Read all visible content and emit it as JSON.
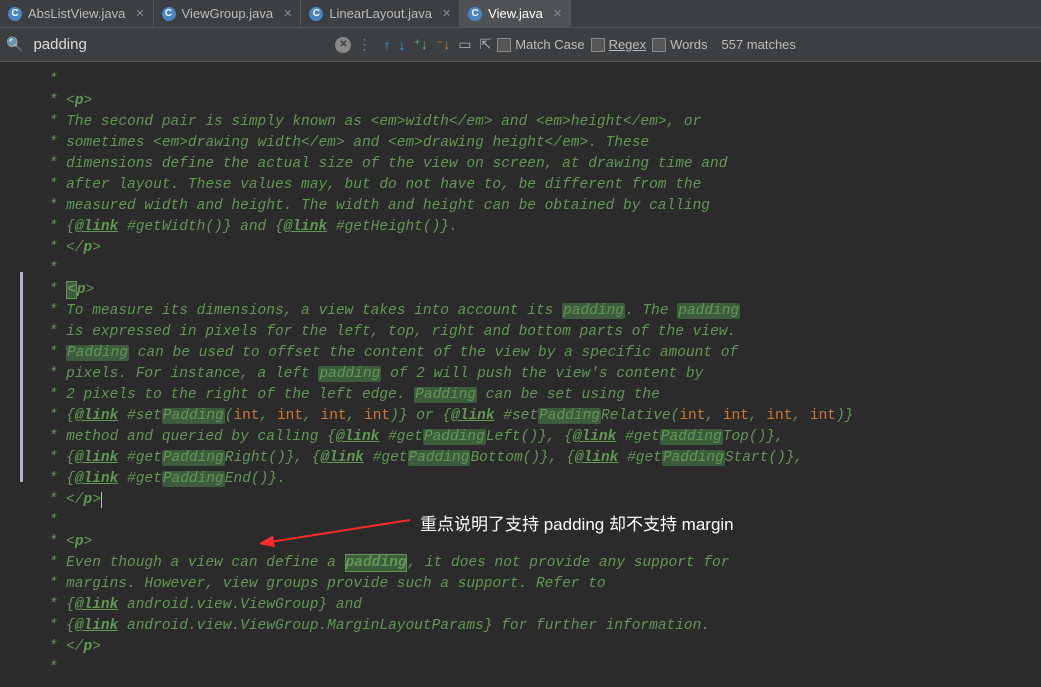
{
  "tabs": [
    {
      "icon": "C",
      "label": "AbsListView.java"
    },
    {
      "icon": "C",
      "label": "ViewGroup.java"
    },
    {
      "icon": "C",
      "label": "LinearLayout.java"
    },
    {
      "icon": "C",
      "label": "View.java"
    }
  ],
  "active_tab": 3,
  "search": {
    "value": "padding",
    "match_case": "Match Case",
    "regex": "Regex",
    "words": "Words",
    "matches": "557 matches"
  },
  "annotation_text": "重点说明了支持 padding 却不支持 margin",
  "code": {
    "l0": " *",
    "l1a": " * <",
    "l1b": "p",
    "l1c": ">",
    "l2": " * The second pair is simply known as <em>width</em> and <em>height</em>, or",
    "l3": " * sometimes <em>drawing width</em> and <em>drawing height</em>. These",
    "l4": " * dimensions define the actual size of the view on screen, at drawing time and",
    "l5": " * after layout. These values may, but do not have to, be different from the",
    "l6": " * measured width and height. The width and height can be obtained by calling",
    "l7a": " * {",
    "l7b": "@link",
    "l7c": " #getWidth()} and {",
    "l7d": "@link",
    "l7e": " #getHeight()}.",
    "l8a": " * </",
    "l8b": "p",
    "l8c": ">",
    "l9": " *",
    "l10a": " * ",
    "l10b": "<",
    "l10c": "p",
    "l10d": ">",
    "l11a": " * To measure its dimensions, a view takes into account its ",
    "l11b": "padding",
    "l11c": ". The ",
    "l11d": "padding",
    "l12": " * is expressed in pixels for the left, top, right and bottom parts of the view.",
    "l13a": " * ",
    "l13b": "Padding",
    "l13c": " can be used to offset the content of the view by a specific amount of",
    "l14a": " * pixels. For instance, a left ",
    "l14b": "padding",
    "l14c": " of 2 will push the view's content by",
    "l15a": " * 2 pixels to the right of the left edge. ",
    "l15b": "Padding",
    "l15c": " can be set using the",
    "l16a": " * {",
    "l16b": "@link",
    "l16c": " #set",
    "l16d": "Padding",
    "l16e": "(",
    "l16f": "int",
    "l16g": ", ",
    "l16h": "int",
    "l16i": ", ",
    "l16j": "int",
    "l16k": ", ",
    "l16l": "int",
    "l16m": ")} or {",
    "l16n": "@link",
    "l16o": " #set",
    "l16p": "Padding",
    "l16q": "Relative(",
    "l16r": "int",
    "l16s": ", ",
    "l16t": "int",
    "l16u": ", ",
    "l16v": "int",
    "l16w": ", ",
    "l16x": "int",
    "l16y": ")}",
    "l17a": " * method and queried by calling {",
    "l17b": "@link",
    "l17c": " #get",
    "l17d": "Padding",
    "l17e": "Left()}, {",
    "l17f": "@link",
    "l17g": " #get",
    "l17h": "Padding",
    "l17i": "Top()},",
    "l18a": " * {",
    "l18b": "@link",
    "l18c": " #get",
    "l18d": "Padding",
    "l18e": "Right()}, {",
    "l18f": "@link",
    "l18g": " #get",
    "l18h": "Padding",
    "l18i": "Bottom()}, {",
    "l18j": "@link",
    "l18k": " #get",
    "l18l": "Padding",
    "l18m": "Start()},",
    "l19a": " * {",
    "l19b": "@link",
    "l19c": " #get",
    "l19d": "Padding",
    "l19e": "End()}.",
    "l20a": " * </",
    "l20b": "p",
    "l20c": ">",
    "l21": " *",
    "l22a": " * <",
    "l22b": "p",
    "l22c": ">",
    "l23a": " * Even though a view can define a ",
    "l23b": "padding",
    "l23c": ", it does not provide any support for",
    "l24": " * margins. However, view groups provide such a support. Refer to",
    "l25a": " * {",
    "l25b": "@link",
    "l25c": " android.view.ViewGroup} and",
    "l26a": " * {",
    "l26b": "@link",
    "l26c": " android.view.ViewGroup.MarginLayoutParams} for further information.",
    "l27a": " * </",
    "l27b": "p",
    "l27c": ">",
    "l28": " *"
  }
}
